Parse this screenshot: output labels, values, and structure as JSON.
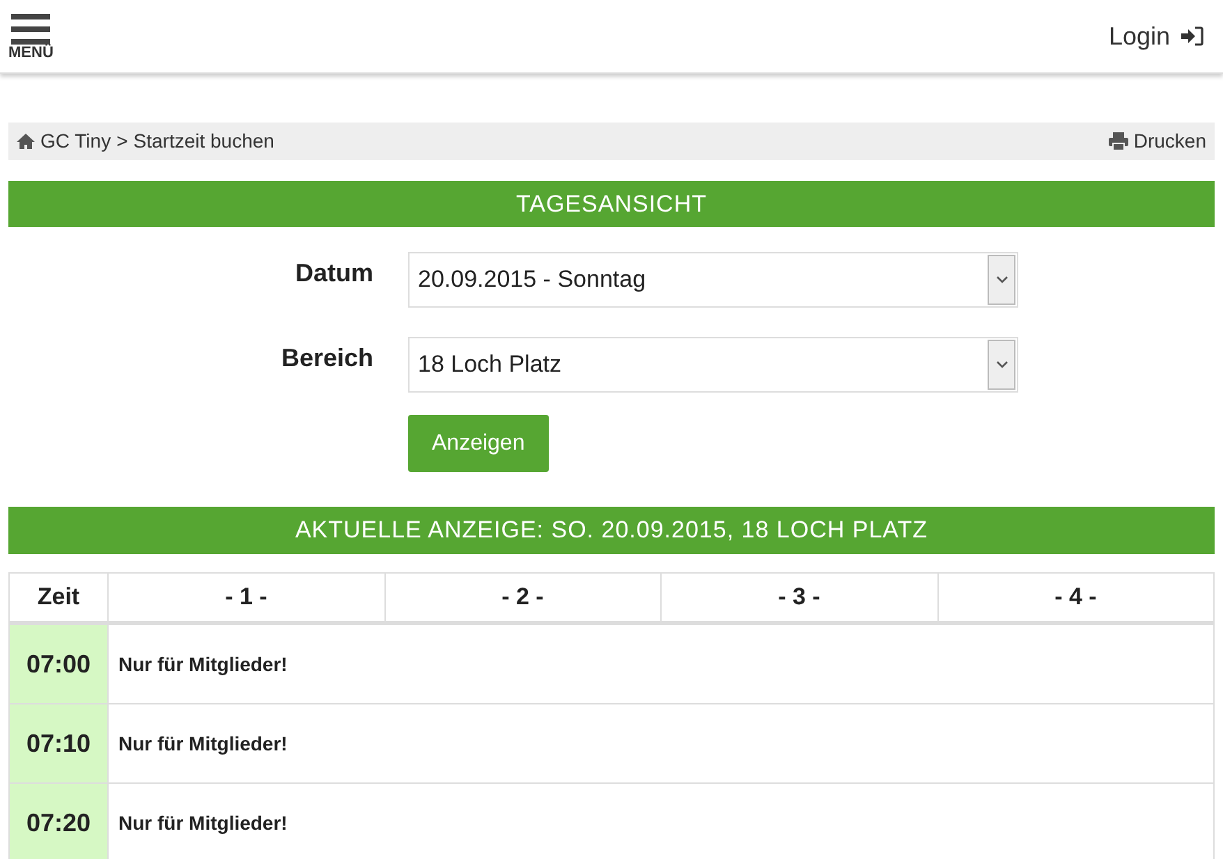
{
  "header": {
    "menu_label": "MENÜ",
    "login": "Login"
  },
  "breadcrumb": {
    "items": [
      "GC Tiny",
      "Startzeit buchen"
    ],
    "separator": ">",
    "print": "Drucken"
  },
  "day_view": {
    "title": "TAGESANSICHT",
    "fields": [
      {
        "label": "Datum",
        "value": "20.09.2015 - Sonntag"
      },
      {
        "label": "Bereich",
        "value": "18 Loch Platz"
      }
    ],
    "button": "Anzeigen"
  },
  "current": {
    "title": "AKTUELLE ANZEIGE: SO. 20.09.2015, 18 LOCH PLATZ"
  },
  "table": {
    "columns": [
      "Zeit",
      "- 1 -",
      "- 2 -",
      "- 3 -",
      "- 4 -"
    ],
    "rows": [
      {
        "time": "07:00",
        "note": "Nur für Mitglieder!"
      },
      {
        "time": "07:10",
        "note": "Nur für Mitglieder!"
      },
      {
        "time": "07:20",
        "note": "Nur für Mitglieder!"
      }
    ]
  }
}
